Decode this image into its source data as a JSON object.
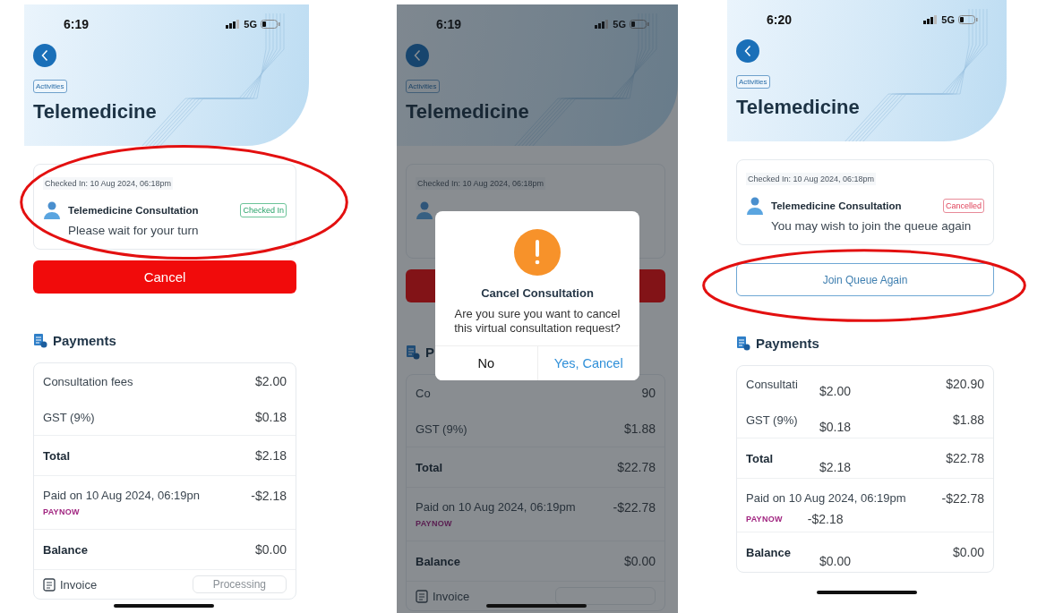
{
  "screens": [
    {
      "time": "6:19",
      "network": "5G",
      "breadcrumb": "Activities",
      "title": "Telemedicine",
      "visit": {
        "checked_in": "Checked In: 10 Aug 2024, 06:18pm",
        "service": "Telemedicine Consultation",
        "status": {
          "label": "Checked In",
          "kind": "checked_in"
        },
        "message": "Please wait for your turn",
        "circled": true
      },
      "action": {
        "label": "Cancel",
        "kind": "danger"
      },
      "payments": {
        "heading": "Payments",
        "rows": [
          {
            "kind": "line",
            "label": "Consultation fees",
            "value": "$2.00"
          },
          {
            "kind": "line",
            "label": "GST (9%)",
            "value": "$0.18"
          },
          {
            "kind": "total",
            "label": "Total",
            "value": "$2.18"
          },
          {
            "kind": "payment",
            "label": "Paid on 10 Aug 2024, 06:19pn",
            "method": "PAYNOW",
            "value": "-$2.18"
          },
          {
            "kind": "total",
            "label": "Balance",
            "value": "$0.00"
          }
        ],
        "invoice": {
          "label": "Invoice",
          "status": "Processing"
        }
      }
    },
    {
      "time": "6:19",
      "network": "5G",
      "dimmed": true,
      "breadcrumb": "Activities",
      "title": "Telemedicine",
      "visit": {
        "checked_in": "Checked In: 10 Aug 2024, 06:18pm"
      },
      "action": {
        "kind": "danger"
      },
      "payments": {
        "heading": "P",
        "rows": [
          {
            "kind": "line",
            "label": "Co",
            "value": "90"
          },
          {
            "kind": "line",
            "label": "GST (9%)",
            "value": "$1.88"
          },
          {
            "kind": "total",
            "label": "Total",
            "value": "$22.78"
          },
          {
            "kind": "payment",
            "label": "Paid on 10 Aug 2024, 06:19pm",
            "method": "PAYNOW",
            "value": "-$22.78"
          },
          {
            "kind": "total",
            "label": "Balance",
            "value": "$0.00"
          }
        ],
        "invoice": {
          "label": "Invoice"
        }
      },
      "dialog": {
        "title": "Cancel Consultation",
        "message": "Are you sure you want to cancel this virtual consultation request?",
        "buttons": [
          {
            "label": "No",
            "kind": "plain"
          },
          {
            "label": "Yes, Cancel",
            "kind": "primary"
          }
        ]
      }
    },
    {
      "time": "6:20",
      "network": "5G",
      "breadcrumb": "Activities",
      "title": "Telemedicine",
      "visit": {
        "checked_in": "Checked In: 10 Aug 2024, 06:18pm",
        "service": "Telemedicine Consultation",
        "status": {
          "label": "Cancelled",
          "kind": "cancelled"
        },
        "message": "You may wish to join the queue again"
      },
      "action": {
        "label": "Join Queue Again",
        "kind": "outline",
        "circled": true
      },
      "payments": {
        "heading": "Payments",
        "rows": [
          {
            "kind": "line",
            "label": "Consultati",
            "value": "$20.90",
            "pasted": "$2.00"
          },
          {
            "kind": "line",
            "label": "GST (9%)",
            "value": "$1.88",
            "pasted": "$0.18"
          },
          {
            "kind": "total",
            "label": "Total",
            "value": "$22.78",
            "pasted": "$2.18"
          },
          {
            "kind": "payment",
            "label": "Paid on 10 Aug 2024, 06:19pm",
            "method": "PAYNOW",
            "value": "-$22.78",
            "pasted": "-$2.18"
          },
          {
            "kind": "total",
            "label": "Balance",
            "value": "$0.00",
            "pasted": "$0.00"
          }
        ]
      }
    }
  ]
}
